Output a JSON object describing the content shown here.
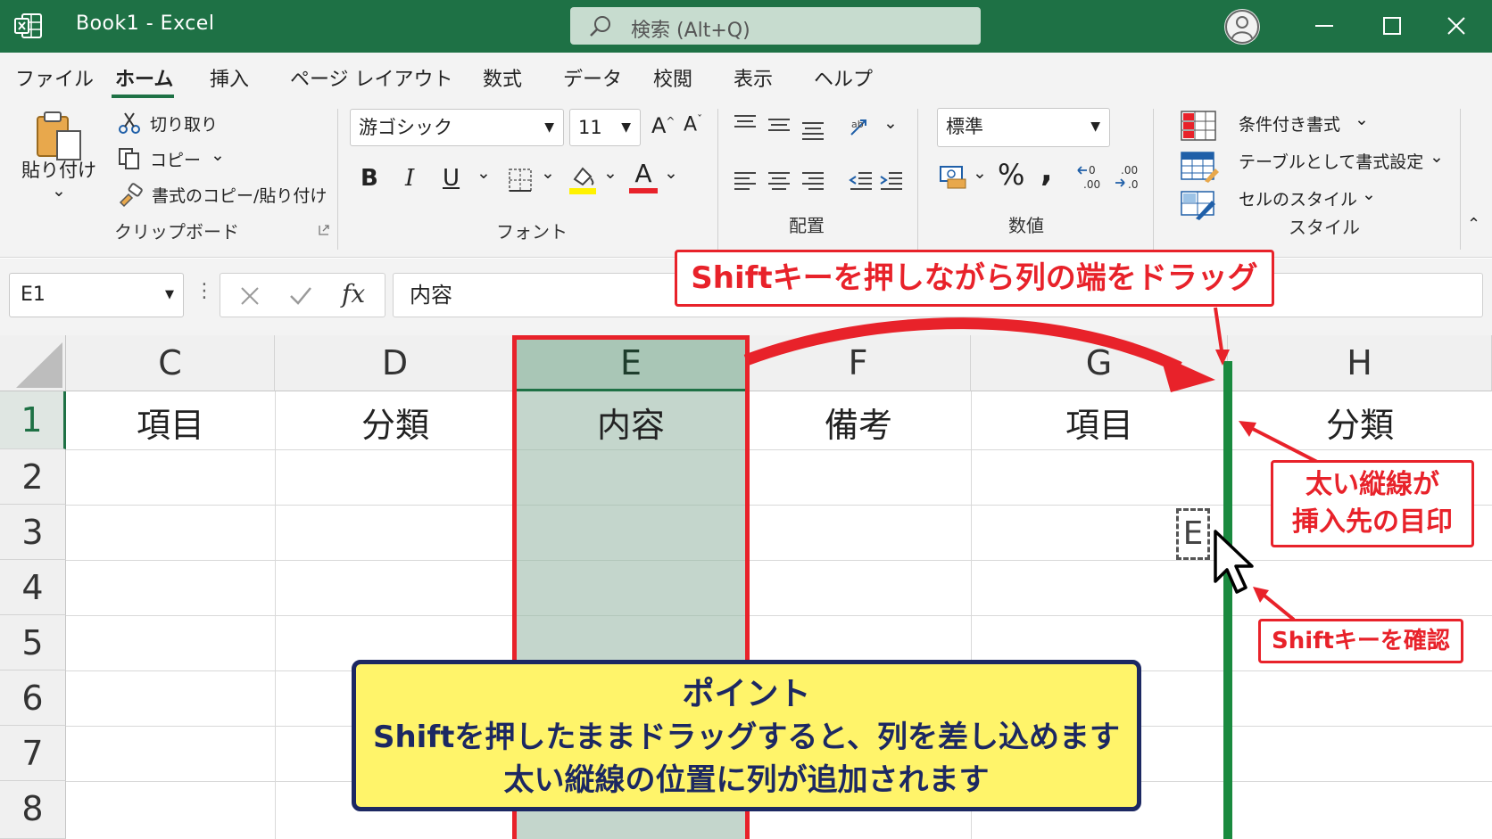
{
  "window": {
    "title": "Book1  -  Excel",
    "search_placeholder": "検索 (Alt+Q)"
  },
  "tabs": [
    "ファイル",
    "ホーム",
    "挿入",
    "ページ レイアウト",
    "数式",
    "データ",
    "校閲",
    "表示",
    "ヘルプ"
  ],
  "active_tab": "ホーム",
  "ribbon": {
    "clipboard": {
      "paste": "貼り付け",
      "cut": "切り取り",
      "copy": "コピー",
      "format_painter": "書式のコピー/貼り付け",
      "group_label": "クリップボード"
    },
    "font": {
      "font_name": "游ゴシック",
      "font_size": "11",
      "bold": "B",
      "italic": "I",
      "underline": "U",
      "font_color_letter": "A",
      "group_label": "フォント"
    },
    "alignment": {
      "group_label": "配置"
    },
    "number": {
      "format": "標準",
      "percent": "%",
      "comma": ",",
      "group_label": "数値"
    },
    "styles": {
      "conditional": "条件付き書式",
      "table": "テーブルとして書式設定",
      "cell_styles": "セルのスタイル",
      "group_label": "スタイル"
    }
  },
  "formula_bar": {
    "name_box": "E1",
    "fx": "fx",
    "content": "内容"
  },
  "grid": {
    "columns": [
      "C",
      "D",
      "E",
      "F",
      "G",
      "H"
    ],
    "rows": [
      "1",
      "2",
      "3",
      "4",
      "5",
      "6",
      "7",
      "8"
    ],
    "row1_values": [
      "項目",
      "分類",
      "内容",
      "備考",
      "項目",
      "分類"
    ],
    "selected_column": "E",
    "drag_ghost_label": "E"
  },
  "annotations": {
    "top_callout": "Shiftキーを押しながら列の端をドラッグ",
    "line_callout": [
      "太い縦線が",
      "挿入先の目印"
    ],
    "shift_callout": "Shiftキーを確認",
    "point": {
      "title": "ポイント",
      "line1": "Shiftを押したままドラッグすると、列を差し込めます",
      "line2": "太い縦線の位置に列が追加されます"
    }
  },
  "colors": {
    "excel_green": "#1e7145",
    "callout_red": "#e8222a",
    "point_yellow": "#fff46a",
    "point_navy": "#1c2862",
    "insert_line": "#1a8a3f"
  }
}
